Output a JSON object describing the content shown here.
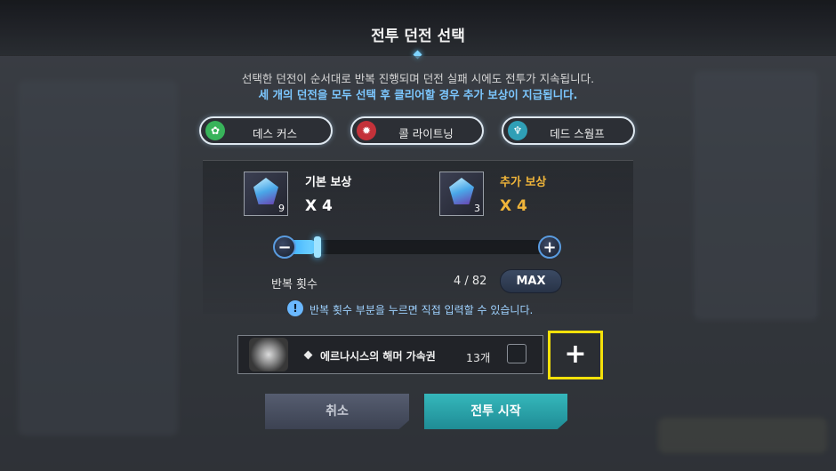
{
  "dialog": {
    "title": "전투 던전 선택",
    "description_line1": "선택한 던전이 순서대로 반복 진행되며 던전 실패 시에도 전투가 지속됩니다.",
    "description_line2": "세 개의 던전을 모두 선택 후 클리어할 경우 추가 보상이 지급됩니다."
  },
  "dungeons": [
    {
      "label": "데스 커스",
      "icon": "green-emblem-icon",
      "color": "#38b35a"
    },
    {
      "label": "콜 라이트닝",
      "icon": "red-emblem-icon",
      "color": "#c4323a"
    },
    {
      "label": "데드 스웜프",
      "icon": "teal-emblem-icon",
      "color": "#2f9fb6"
    }
  ],
  "rewards": {
    "basic": {
      "title": "기본 보상",
      "qty": "X 4",
      "icon_count": "9",
      "color": "#ffffff"
    },
    "bonus": {
      "title": "추가 보상",
      "qty": "X 4",
      "icon_count": "3",
      "color": "#f0b53a"
    }
  },
  "repeat": {
    "label": "반복 횟수",
    "count": "4 / 82",
    "current": 4,
    "max": 82,
    "max_label": "MAX",
    "minus_symbol": "−",
    "plus_symbol": "+"
  },
  "info": {
    "icon": "!",
    "text": "반복 횟수 부분을 누르면 직접 입력할 수 있습니다."
  },
  "ticket": {
    "name": "에르나시스의 해머 가속권",
    "count": "13개",
    "add_symbol": "+"
  },
  "actions": {
    "cancel": "취소",
    "start": "전투 시작"
  },
  "colors": {
    "highlight": "#f5e10a",
    "accent_blue": "#7cc7ff",
    "start_button": "#2aa4ab"
  }
}
